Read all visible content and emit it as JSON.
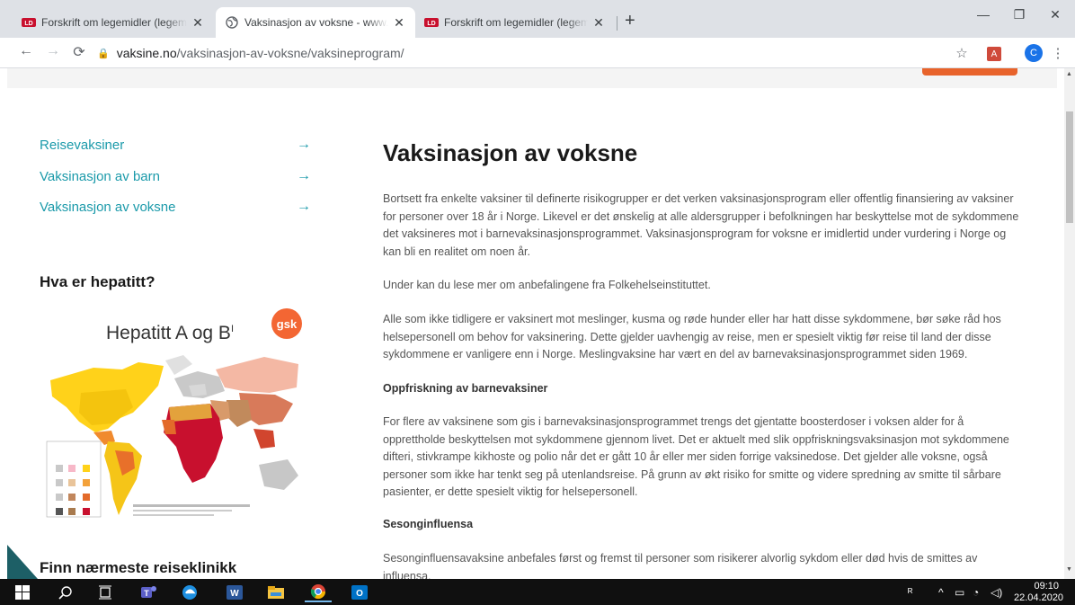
{
  "tabs": [
    {
      "title": "Forskrift om legemidler (legemid",
      "icon": "lovdata-icon",
      "active": false
    },
    {
      "title": "Vaksinasjon av voksne - www.vak",
      "icon": "globe-icon",
      "active": true
    },
    {
      "title": "Forskrift om legemidler (legemid",
      "icon": "lovdata-icon",
      "active": false
    }
  ],
  "tab_icon_text": "LD",
  "new_tab_label": "+",
  "window_controls": {
    "minimize": "—",
    "restore": "❐",
    "close": "✕"
  },
  "url": {
    "host": "vaksine.no",
    "path": "/vaksinasjon-av-voksne/vaksineprogram/"
  },
  "toolbar": {
    "profile_initial": "C",
    "pdf_label": "A"
  },
  "sidebar": {
    "links": [
      {
        "label": "Reisevaksiner",
        "arrow": "→"
      },
      {
        "label": "Vaksinasjon av barn",
        "arrow": "→"
      },
      {
        "label": "Vaksinasjon av voksne",
        "arrow": "→"
      }
    ],
    "heading": "Hva er hepatitt?",
    "map_title": "Hepatitt A og B",
    "map_title_sup": "I",
    "gsk_logo": "gsk",
    "heading2": "Finn nærmeste reiseklinikk"
  },
  "main": {
    "title": "Vaksinasjon av voksne",
    "p1": "Bortsett fra enkelte vaksiner til definerte risikogrupper er det verken vaksinasjonsprogram eller offentlig finansiering av vaksiner for personer over 18 år i Norge. Likevel er det ønskelig at alle aldersgrupper i befolkningen har beskyttelse mot de sykdommene det vaksineres mot i barnevaksinasjonsprogrammet. Vaksinasjonsprogram for voksne er imidlertid under vurdering i Norge og kan bli en realitet om noen år.",
    "p2": "Under kan du lese mer om anbefalingene fra Folkehelseinstituttet.",
    "p3": "Alle som ikke tidligere er vaksinert mot meslinger, kusma og røde hunder eller har hatt disse sykdommene, bør søke råd hos helsepersonell om behov for vaksinering. Dette gjelder uavhengig av reise, men er spesielt viktig før reise til land der disse sykdommene er vanligere enn i Norge. Meslingvaksine har vært en del av barnevaksinasjonsprogrammet siden 1969.",
    "h_oppfriskning": "Oppfriskning av barnevaksiner",
    "p4": "For flere av vaksinene som gis i barnevaksinasjonsprogrammet trengs det gjentatte boosterdoser i voksen alder for å opprettholde beskyttelsen mot sykdommene gjennom livet. Det er aktuelt med slik oppfriskningsvaksinasjon mot sykdommene difteri, stivkrampe kikhoste og polio når det er gått 10 år eller mer siden forrige vaksinedose. Det gjelder alle voksne, også personer som ikke har tenkt seg på utenlandsreise. På grunn av økt risiko for smitte og videre spredning av smitte til sårbare pasienter, er dette spesielt viktig for helsepersonell.",
    "h_sesong": "Sesonginfluensa",
    "p5": "Sesonginfluensavaksine anbefales først og fremst til personer som risikerer alvorlig sykdom eller død hvis de smittes av influensa."
  },
  "taskbar": {
    "time": "09:10",
    "date": "22.04.2020",
    "icons": [
      "windows-start-icon",
      "search-icon",
      "task-view-icon",
      "teams-icon",
      "edge-icon",
      "word-icon",
      "file-explorer-icon",
      "chrome-icon",
      "outlook-icon"
    ],
    "labels": {
      "teams": "T",
      "word": "W",
      "outlook": "O"
    }
  },
  "colors": {
    "accent": "#1b9aaa",
    "orange": "#e8632b",
    "teal_dark": "#1d5f66",
    "gsk": "#f36633"
  }
}
